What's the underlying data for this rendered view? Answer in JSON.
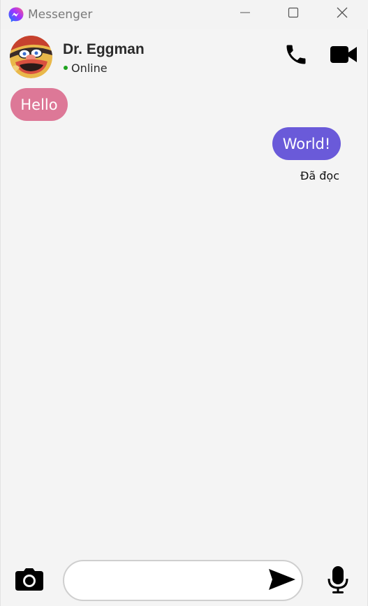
{
  "window": {
    "title": "Messenger",
    "controls": {
      "minimize_icon": "minimize-icon",
      "maximize_icon": "maximize-icon",
      "close_icon": "close-icon"
    }
  },
  "header": {
    "contact_name": "Dr. Eggman",
    "status": "Online",
    "status_color": "#1ea21e",
    "call_icon": "phone-icon",
    "video_icon": "video-camera-icon"
  },
  "messages": [
    {
      "direction": "incoming",
      "text": "Hello",
      "color": "#dd7897"
    },
    {
      "direction": "outgoing",
      "text": "World!",
      "color": "#6a5ad9"
    }
  ],
  "read_receipt": "Đã đọc",
  "composer": {
    "input_value": "",
    "input_placeholder": "",
    "camera_icon": "camera-icon",
    "send_icon": "send-icon",
    "mic_icon": "microphone-icon"
  }
}
